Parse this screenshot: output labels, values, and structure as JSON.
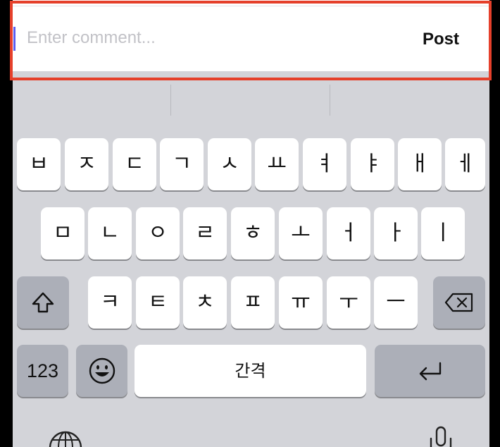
{
  "comment": {
    "placeholder": "Enter comment...",
    "post_label": "Post"
  },
  "keyboard": {
    "row1": [
      "ㅂ",
      "ㅈ",
      "ㄷ",
      "ㄱ",
      "ㅅ",
      "ㅛ",
      "ㅕ",
      "ㅑ",
      "ㅐ",
      "ㅔ"
    ],
    "row2": [
      "ㅁ",
      "ㄴ",
      "ㅇ",
      "ㄹ",
      "ㅎ",
      "ㅗ",
      "ㅓ",
      "ㅏ",
      "ㅣ"
    ],
    "row3": [
      "ㅋ",
      "ㅌ",
      "ㅊ",
      "ㅍ",
      "ㅠ",
      "ㅜ",
      "ㅡ"
    ],
    "numbers_label": "123",
    "space_label": "간격",
    "icons": {
      "shift": "shift-icon",
      "delete": "backspace-icon",
      "emoji": "emoji-icon",
      "return": "return-icon",
      "globe": "globe-icon",
      "dictation": "microphone-icon"
    }
  },
  "colors": {
    "highlight_border": "#e5402b",
    "caret": "#5b5ef0",
    "keyboard_bg": "#d3d4d9",
    "special_key_bg": "#acafb8"
  }
}
